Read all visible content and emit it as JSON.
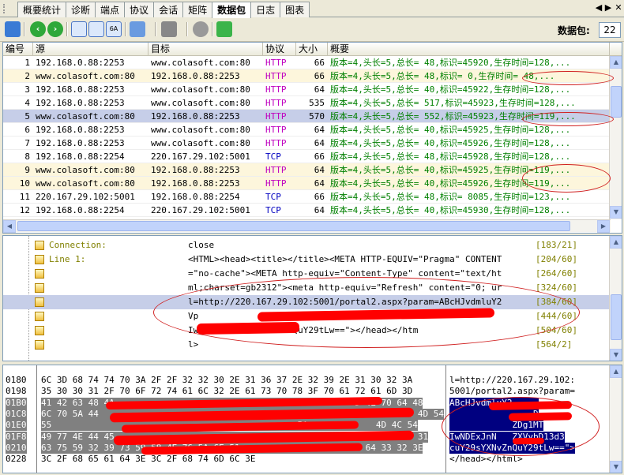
{
  "tabs": [
    "概要统计",
    "诊断",
    "端点",
    "协议",
    "会话",
    "矩阵",
    "数据包",
    "日志",
    "图表"
  ],
  "active_tab": "数据包",
  "toolbar": {
    "packet_label": "数据包:",
    "packet_count": "22"
  },
  "packet_list": {
    "columns": [
      "编号",
      "源",
      "目标",
      "协议",
      "大小",
      "概要"
    ],
    "rows": [
      {
        "no": "1",
        "src": "192.168.0.88:2253",
        "dst": "www.colasoft.com:80",
        "proto": "HTTP",
        "size": "66",
        "summary": "版本=4,头长=5,总长=  48,标识=45920,生存时间=128,...",
        "style": ""
      },
      {
        "no": "2",
        "src": "www.colasoft.com:80",
        "dst": "192.168.0.88:2253",
        "proto": "HTTP",
        "size": "66",
        "summary": "版本=4,头长=5,总长=  48,标识=    0,生存时间= 48,...",
        "style": "warn"
      },
      {
        "no": "3",
        "src": "192.168.0.88:2253",
        "dst": "www.colasoft.com:80",
        "proto": "HTTP",
        "size": "64",
        "summary": "版本=4,头长=5,总长=  40,标识=45922,生存时间=128,...",
        "style": ""
      },
      {
        "no": "4",
        "src": "192.168.0.88:2253",
        "dst": "www.colasoft.com:80",
        "proto": "HTTP",
        "size": "535",
        "summary": "版本=4,头长=5,总长= 517,标识=45923,生存时间=128,...",
        "style": ""
      },
      {
        "no": "5",
        "src": "www.colasoft.com:80",
        "dst": "192.168.0.88:2253",
        "proto": "HTTP",
        "size": "570",
        "summary": "版本=4,头长=5,总长= 552,标识=45923,生存时间=119,...",
        "style": "sel"
      },
      {
        "no": "6",
        "src": "192.168.0.88:2253",
        "dst": "www.colasoft.com:80",
        "proto": "HTTP",
        "size": "64",
        "summary": "版本=4,头长=5,总长=  40,标识=45925,生存时间=128,...",
        "style": ""
      },
      {
        "no": "7",
        "src": "192.168.0.88:2253",
        "dst": "www.colasoft.com:80",
        "proto": "HTTP",
        "size": "64",
        "summary": "版本=4,头长=5,总长=  40,标识=45926,生存时间=128,...",
        "style": ""
      },
      {
        "no": "8",
        "src": "192.168.0.88:2254",
        "dst": "220.167.29.102:5001",
        "proto": "TCP",
        "size": "66",
        "summary": "版本=4,头长=5,总长=  48,标识=45928,生存时间=128,...",
        "style": ""
      },
      {
        "no": "9",
        "src": "www.colasoft.com:80",
        "dst": "192.168.0.88:2253",
        "proto": "HTTP",
        "size": "64",
        "summary": "版本=4,头长=5,总长=  40,标识=45925,生存时间=119,...",
        "style": "warn"
      },
      {
        "no": "10",
        "src": "www.colasoft.com:80",
        "dst": "192.168.0.88:2253",
        "proto": "HTTP",
        "size": "64",
        "summary": "版本=4,头长=5,总长=  40,标识=45926,生存时间=119,...",
        "style": "warn"
      },
      {
        "no": "11",
        "src": "220.167.29.102:5001",
        "dst": "192.168.0.88:2254",
        "proto": "TCP",
        "size": "66",
        "summary": "版本=4,头长=5,总长=  48,标识= 8085,生存时间=123,...",
        "style": ""
      },
      {
        "no": "12",
        "src": "192.168.0.88:2254",
        "dst": "220.167.29.102:5001",
        "proto": "TCP",
        "size": "64",
        "summary": "版本=4,头长=5,总长=  40,标识=45930,生存时间=128,...",
        "style": ""
      }
    ]
  },
  "details": [
    {
      "name": "Connection:",
      "value": "close",
      "offset": "[183/21]",
      "sel": false
    },
    {
      "name": "Line 1:",
      "value": "<HTML><head><title></title><META HTTP-EQUIV=\"Pragma\" CONTENT",
      "offset": "[204/60]",
      "sel": false
    },
    {
      "name": "",
      "value": "=\"no-cache\"><META http-equiv=\"Content-Type\" content=\"text/ht",
      "offset": "[264/60]",
      "sel": false
    },
    {
      "name": "",
      "value": "ml;charset=gb2312\"><meta http-equiv=\"Refresh\" content=\"0; ur",
      "offset": "[324/60]",
      "sel": false
    },
    {
      "name": "",
      "value": "l=http://220.167.29.102:5001/portal2.aspx?param=ABcHJvdmluY2",
      "offset": "[384/60]",
      "sel": true
    },
    {
      "name": "",
      "value": "Vp",
      "offset": "[444/60]",
      "sel": false
    },
    {
      "name": "",
      "value": "Iw                  D13d3cuY29sYXNvZnQuY29tLw==\"></head></htm",
      "offset": "[504/60]",
      "sel": false
    },
    {
      "name": "",
      "value": "l>",
      "offset": "[564/2]",
      "sel": false
    }
  ],
  "hex": [
    {
      "off": "0180",
      "bytes": "6C 3D 68 74 74 70 3A 2F 2F 32 32 30 2E 31 36 37 2E 32 39 2E 31 30 32 3A",
      "ascii": "l=http://220.167.29.102:",
      "sel": false
    },
    {
      "off": "0198",
      "bytes": "35 30 30 31 2F 70 6F 72 74 61 6C 32 2E 61 73 70 78 3F 70 61 72 61 6D 3D",
      "ascii": "5001/portal2.aspx?param=",
      "sel": false
    },
    {
      "off": "01B0",
      "bytes": "41 42 63 48 4A                                              D 4E 70 64 48",
      "ascii": "ABcHJvdmluY2     ",
      "sel": true
    },
    {
      "off": "01C8",
      "bytes": "6C 70 5A 44                                                       6E 51 4D 54",
      "ascii": "                D",
      "sel": true
    },
    {
      "off": "01E0",
      "bytes": "55                                               5A             4D 4C 54",
      "ascii": "            ZDg1MT",
      "sel": true
    },
    {
      "off": "01F8",
      "bytes": "49 77 4E 44 45                                                 59 62 44 31",
      "ascii": "IwNDExJnN   ZXVybD13d3",
      "sel": true
    },
    {
      "off": "0210",
      "bytes": "63 75 59 32 39 73 59 58 4E 76 5A 6E 51                        64 33 32 3E",
      "ascii": "cuY29sYXNvZnQuY29tLw==\">",
      "sel": true
    },
    {
      "off": "0228",
      "bytes": "3C 2F 68 65 61 64 3E 3C 2F 68 74 6D 6C 3E",
      "ascii": "</head></html>",
      "sel": false
    }
  ],
  "colors": {
    "summary_text": "#008000",
    "http": "#c000c0",
    "tcp": "#0000c0",
    "selected_row": "#c6cee8",
    "highlight_row": "#fdf6dc",
    "annotation_red": "#ff0000"
  },
  "icons": [
    "grid-icon",
    "back-icon",
    "forward-icon",
    "view-list-icon",
    "view-detail-icon",
    "view-hex-icon",
    "filter-icon",
    "tools-icon",
    "decode-icon",
    "refresh-icon",
    "close-icon"
  ]
}
